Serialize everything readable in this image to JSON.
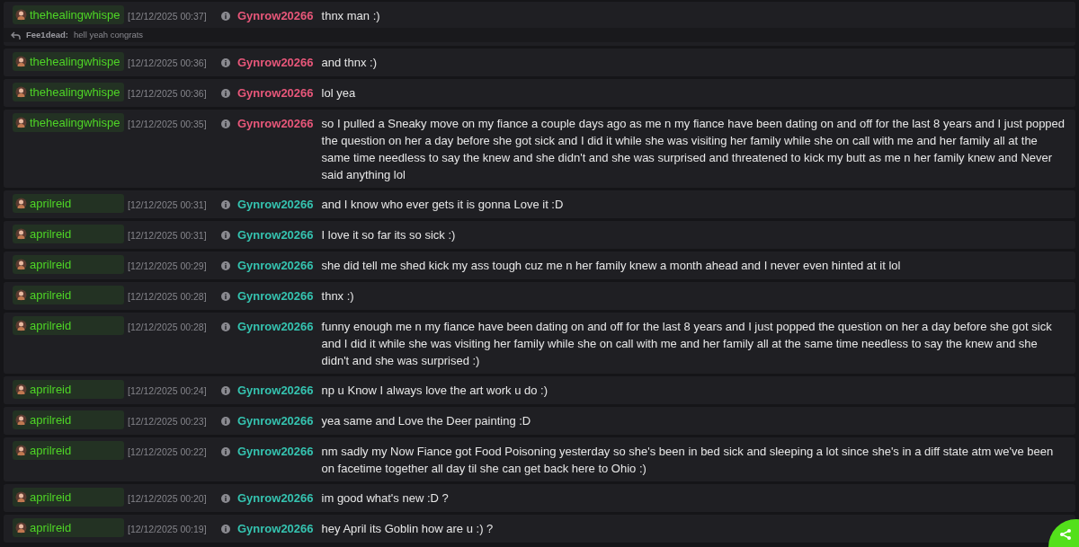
{
  "messages": [
    {
      "channel": "thehealingwhispe",
      "time": "[12/12/2025 00:37]",
      "user": "Gynrow20266",
      "color": "#e8577a",
      "text": "thnx man :)",
      "reply": {
        "user": "Fee1dead:",
        "text": "hell yeah congrats"
      }
    },
    {
      "channel": "thehealingwhispe",
      "time": "[12/12/2025 00:36]",
      "user": "Gynrow20266",
      "color": "#e8577a",
      "text": "and thnx :)"
    },
    {
      "channel": "thehealingwhispe",
      "time": "[12/12/2025 00:36]",
      "user": "Gynrow20266",
      "color": "#e8577a",
      "text": "lol yea"
    },
    {
      "channel": "thehealingwhispe",
      "time": "[12/12/2025 00:35]",
      "user": "Gynrow20266",
      "color": "#e8577a",
      "text": "so I pulled a Sneaky move on my fiance a couple days ago as me n my fiance have been dating on and off for the last 8 years and I just popped the question on her a day before she got sick and I did it while she was visiting her family while she on call with me and her family all at the same time needless to say the knew and she didn't and she was surprised and threatened to kick my butt as me n her family knew and Never said anything lol"
    },
    {
      "channel": "aprilreid",
      "time": "[12/12/2025 00:31]",
      "user": "Gynrow20266",
      "color": "#35c3b0",
      "text": "and I know who ever gets it is gonna Love it :D"
    },
    {
      "channel": "aprilreid",
      "time": "[12/12/2025 00:31]",
      "user": "Gynrow20266",
      "color": "#35c3b0",
      "text": "I love it so far its so sick :)"
    },
    {
      "channel": "aprilreid",
      "time": "[12/12/2025 00:29]",
      "user": "Gynrow20266",
      "color": "#35c3b0",
      "text": "she did tell me shed kick my ass tough cuz me n her family knew a month ahead and I never even hinted at it lol"
    },
    {
      "channel": "aprilreid",
      "time": "[12/12/2025 00:28]",
      "user": "Gynrow20266",
      "color": "#35c3b0",
      "text": "thnx :)"
    },
    {
      "channel": "aprilreid",
      "time": "[12/12/2025 00:28]",
      "user": "Gynrow20266",
      "color": "#35c3b0",
      "text": "funny enough me n my fiance have been dating on and off for the last 8 years and I just popped the question on her a day before she got sick and I did it while she was visiting her family while she on call with me and her family all at the same time needless to say the knew and she didn't and she was surprised :)"
    },
    {
      "channel": "aprilreid",
      "time": "[12/12/2025 00:24]",
      "user": "Gynrow20266",
      "color": "#35c3b0",
      "text": "np u Know I always love the art work u do :)"
    },
    {
      "channel": "aprilreid",
      "time": "[12/12/2025 00:23]",
      "user": "Gynrow20266",
      "color": "#35c3b0",
      "text": "yea same and Love the Deer painting :D"
    },
    {
      "channel": "aprilreid",
      "time": "[12/12/2025 00:22]",
      "user": "Gynrow20266",
      "color": "#35c3b0",
      "text": "nm sadly my Now Fiance got Food Poisoning yesterday so she's been in bed sick and sleeping a lot since she's in a diff state atm we've been on facetime together all day til she can get back here to Ohio :)"
    },
    {
      "channel": "aprilreid",
      "time": "[12/12/2025 00:20]",
      "user": "Gynrow20266",
      "color": "#35c3b0",
      "text": "im good what's new :D ?"
    },
    {
      "channel": "aprilreid",
      "time": "[12/12/2025 00:19]",
      "user": "Gynrow20266",
      "color": "#35c3b0",
      "text": "hey April its Goblin how are u :) ?"
    }
  ]
}
